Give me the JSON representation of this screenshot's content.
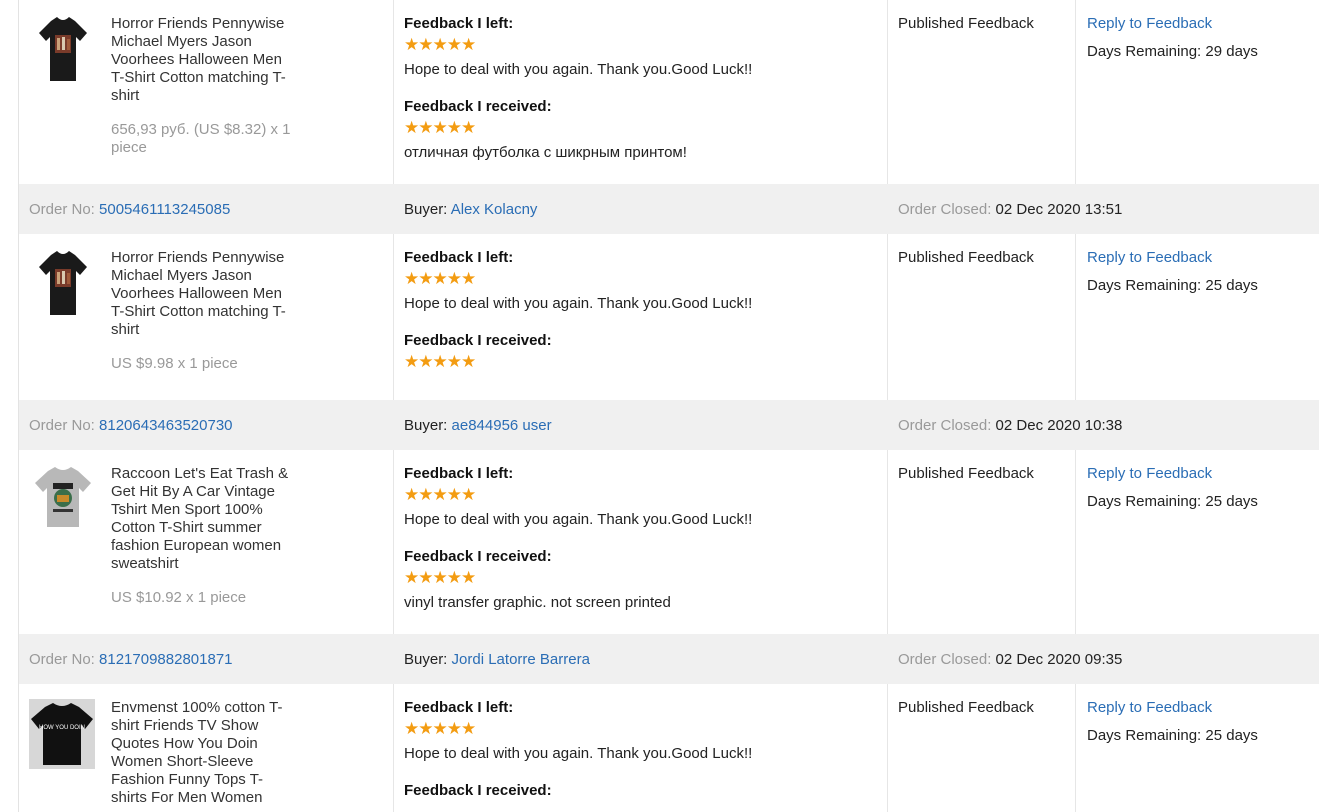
{
  "labels": {
    "order_no": "Order No:",
    "buyer": "Buyer:",
    "order_closed": "Order Closed:",
    "feedback_left": "Feedback I left:",
    "feedback_received": "Feedback I received:",
    "published": "Published Feedback",
    "reply": "Reply to Feedback",
    "days_remaining": "Days Remaining:"
  },
  "stars": "★★★★★",
  "rows": [
    {
      "product_title": "Horror Friends Pennywise Michael Myers Jason Voorhees Halloween Men T-Shirt Cotton matching T-shirt",
      "price": "656,93 руб. (US $8.32) x 1 piece",
      "feedback_left_text": "Hope to deal with you again. Thank you.Good Luck!!",
      "feedback_received_text": "отличная футболка с шикрным принтом!",
      "days": "29 days",
      "icon": "tshirt-black-horror"
    },
    {
      "order_no": "5005461113245085",
      "buyer": "Alex Kolacny",
      "closed": "02 Dec 2020 13:51",
      "product_title": "Horror Friends Pennywise Michael Myers Jason Voorhees Halloween Men T-Shirt Cotton matching T-shirt",
      "price": "US $9.98 x 1 piece",
      "feedback_left_text": "Hope to deal with you again. Thank you.Good Luck!!",
      "feedback_received_text": "",
      "days": "25 days",
      "icon": "tshirt-black-horror"
    },
    {
      "order_no": "8120643463520730",
      "buyer": "ae844956 user",
      "closed": "02 Dec 2020 10:38",
      "product_title": "Raccoon Let's Eat Trash & Get Hit By A Car Vintage Tshirt Men Sport 100% Cotton T-Shirt summer fashion European women sweatshirt",
      "price": "US $10.92 x 1 piece",
      "feedback_left_text": "Hope to deal with you again. Thank you.Good Luck!!",
      "feedback_received_text": "vinyl transfer graphic. not screen printed",
      "days": "25 days",
      "icon": "tshirt-grey-raccoon"
    },
    {
      "order_no": "8121709882801871",
      "buyer": "Jordi Latorre Barrera",
      "closed": "02 Dec 2020 09:35",
      "product_title": "Envmenst 100% cotton T-shirt Friends TV Show Quotes How You Doin Women Short-Sleeve Fashion Funny Tops T-shirts For Men Women",
      "feedback_left_text": "Hope to deal with you again. Thank you.Good Luck!!",
      "days": "25 days",
      "icon": "tshirt-black-friends",
      "thumb_text": "HOW YOU DOIN"
    }
  ]
}
